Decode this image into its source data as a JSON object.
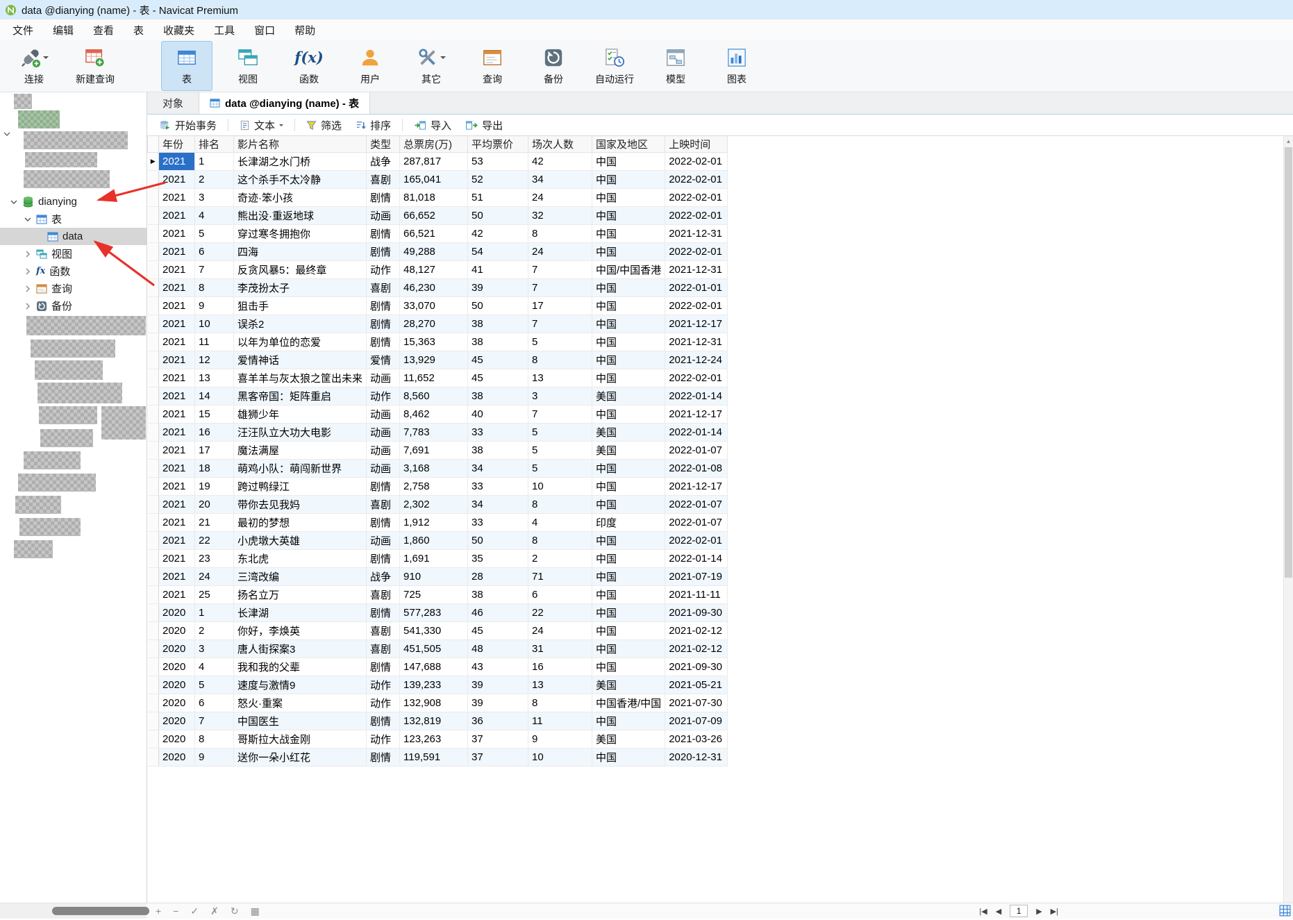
{
  "window": {
    "title": "data @dianying (name) - 表 - Navicat Premium"
  },
  "menubar": [
    "文件",
    "编辑",
    "查看",
    "表",
    "收藏夹",
    "工具",
    "窗口",
    "帮助"
  ],
  "main_toolbar": [
    {
      "label": "连接"
    },
    {
      "label": "新建查询"
    },
    {
      "label": "表",
      "active": true
    },
    {
      "label": "视图"
    },
    {
      "label": "函数"
    },
    {
      "label": "用户"
    },
    {
      "label": "其它"
    },
    {
      "label": "查询"
    },
    {
      "label": "备份"
    },
    {
      "label": "自动运行"
    },
    {
      "label": "模型"
    },
    {
      "label": "图表"
    }
  ],
  "sidebar": {
    "database": "dianying",
    "tables_group": "表",
    "table": "data",
    "views": "视图",
    "functions": "函数",
    "queries": "查询",
    "backups": "备份"
  },
  "tabs": {
    "objects": "对象",
    "active": "data @dianying (name) - 表"
  },
  "table_toolbar": {
    "begin_transaction": "开始事务",
    "text": "文本",
    "filter": "筛选",
    "sort": "排序",
    "import": "导入",
    "export": "导出"
  },
  "grid": {
    "columns": [
      "年份",
      "排名",
      "影片名称",
      "类型",
      "总票房(万)",
      "平均票价",
      "场次人数",
      "国家及地区",
      "上映时间"
    ],
    "rows": [
      [
        "2021",
        "1",
        "长津湖之水门桥",
        "战争",
        "287,817",
        "53",
        "42",
        "中国",
        "2022-02-01"
      ],
      [
        "2021",
        "2",
        "这个杀手不太冷静",
        "喜剧",
        "165,041",
        "52",
        "34",
        "中国",
        "2022-02-01"
      ],
      [
        "2021",
        "3",
        "奇迹·笨小孩",
        "剧情",
        "81,018",
        "51",
        "24",
        "中国",
        "2022-02-01"
      ],
      [
        "2021",
        "4",
        "熊出没·重返地球",
        "动画",
        "66,652",
        "50",
        "32",
        "中国",
        "2022-02-01"
      ],
      [
        "2021",
        "5",
        "穿过寒冬拥抱你",
        "剧情",
        "66,521",
        "42",
        "8",
        "中国",
        "2021-12-31"
      ],
      [
        "2021",
        "6",
        "四海",
        "剧情",
        "49,288",
        "54",
        "24",
        "中国",
        "2022-02-01"
      ],
      [
        "2021",
        "7",
        "反贪风暴5：最终章",
        "动作",
        "48,127",
        "41",
        "7",
        "中国/中国香港",
        "2021-12-31"
      ],
      [
        "2021",
        "8",
        "李茂扮太子",
        "喜剧",
        "46,230",
        "39",
        "7",
        "中国",
        "2022-01-01"
      ],
      [
        "2021",
        "9",
        "狙击手",
        "剧情",
        "33,070",
        "50",
        "17",
        "中国",
        "2022-02-01"
      ],
      [
        "2021",
        "10",
        "误杀2",
        "剧情",
        "28,270",
        "38",
        "7",
        "中国",
        "2021-12-17"
      ],
      [
        "2021",
        "11",
        "以年为单位的恋爱",
        "剧情",
        "15,363",
        "38",
        "5",
        "中国",
        "2021-12-31"
      ],
      [
        "2021",
        "12",
        "爱情神话",
        "爱情",
        "13,929",
        "45",
        "8",
        "中国",
        "2021-12-24"
      ],
      [
        "2021",
        "13",
        "喜羊羊与灰太狼之筐出未来",
        "动画",
        "11,652",
        "45",
        "13",
        "中国",
        "2022-02-01"
      ],
      [
        "2021",
        "14",
        "黑客帝国：矩阵重启",
        "动作",
        "8,560",
        "38",
        "3",
        "美国",
        "2022-01-14"
      ],
      [
        "2021",
        "15",
        "雄狮少年",
        "动画",
        "8,462",
        "40",
        "7",
        "中国",
        "2021-12-17"
      ],
      [
        "2021",
        "16",
        "汪汪队立大功大电影",
        "动画",
        "7,783",
        "33",
        "5",
        "美国",
        "2022-01-14"
      ],
      [
        "2021",
        "17",
        "魔法满屋",
        "动画",
        "7,691",
        "38",
        "5",
        "美国",
        "2022-01-07"
      ],
      [
        "2021",
        "18",
        "萌鸡小队：萌闯新世界",
        "动画",
        "3,168",
        "34",
        "5",
        "中国",
        "2022-01-08"
      ],
      [
        "2021",
        "19",
        "跨过鸭绿江",
        "剧情",
        "2,758",
        "33",
        "10",
        "中国",
        "2021-12-17"
      ],
      [
        "2021",
        "20",
        "带你去见我妈",
        "喜剧",
        "2,302",
        "34",
        "8",
        "中国",
        "2022-01-07"
      ],
      [
        "2021",
        "21",
        "最初的梦想",
        "剧情",
        "1,912",
        "33",
        "4",
        "印度",
        "2022-01-07"
      ],
      [
        "2021",
        "22",
        "小虎墩大英雄",
        "动画",
        "1,860",
        "50",
        "8",
        "中国",
        "2022-02-01"
      ],
      [
        "2021",
        "23",
        "东北虎",
        "剧情",
        "1,691",
        "35",
        "2",
        "中国",
        "2022-01-14"
      ],
      [
        "2021",
        "24",
        "三湾改编",
        "战争",
        "910",
        "28",
        "71",
        "中国",
        "2021-07-19"
      ],
      [
        "2021",
        "25",
        "扬名立万",
        "喜剧",
        "725",
        "38",
        "6",
        "中国",
        "2021-11-11"
      ],
      [
        "2020",
        "1",
        "长津湖",
        "剧情",
        "577,283",
        "46",
        "22",
        "中国",
        "2021-09-30"
      ],
      [
        "2020",
        "2",
        "你好，李焕英",
        "喜剧",
        "541,330",
        "45",
        "24",
        "中国",
        "2021-02-12"
      ],
      [
        "2020",
        "3",
        "唐人街探案3",
        "喜剧",
        "451,505",
        "48",
        "31",
        "中国",
        "2021-02-12"
      ],
      [
        "2020",
        "4",
        "我和我的父辈",
        "剧情",
        "147,688",
        "43",
        "16",
        "中国",
        "2021-09-30"
      ],
      [
        "2020",
        "5",
        "速度与激情9",
        "动作",
        "139,233",
        "39",
        "13",
        "美国",
        "2021-05-21"
      ],
      [
        "2020",
        "6",
        "怒火·重案",
        "动作",
        "132,908",
        "39",
        "8",
        "中国香港/中国",
        "2021-07-30"
      ],
      [
        "2020",
        "7",
        "中国医生",
        "剧情",
        "132,819",
        "36",
        "11",
        "中国",
        "2021-07-09"
      ],
      [
        "2020",
        "8",
        "哥斯拉大战金刚",
        "动作",
        "123,263",
        "37",
        "9",
        "美国",
        "2021-03-26"
      ],
      [
        "2020",
        "9",
        "送你一朵小红花",
        "剧情",
        "119,591",
        "37",
        "10",
        "中国",
        "2020-12-31"
      ]
    ]
  },
  "statusbar": {
    "record": "1"
  },
  "icons": {
    "connection": "plug",
    "new_query": "table-plus",
    "tables": "table-grid",
    "views": "double-table",
    "functions": "f(x)",
    "users": "person",
    "others": "crossed-tools",
    "query": "query-window",
    "backup": "circular-arrow",
    "automation": "checklist-clock",
    "model": "diagram-window",
    "charts": "bar-chart",
    "database": "db-cylinder",
    "begin_transaction": "db-play",
    "text": "document-lines",
    "filter": "funnel",
    "sort": "sort-arrow",
    "import": "arrow-into-table",
    "export": "arrow-out-of-table"
  },
  "colors": {
    "selection": "#2a70c8",
    "accent": "#2f7bd0",
    "annotation": "#e8312a",
    "titlebar": "#d9ecfb"
  }
}
